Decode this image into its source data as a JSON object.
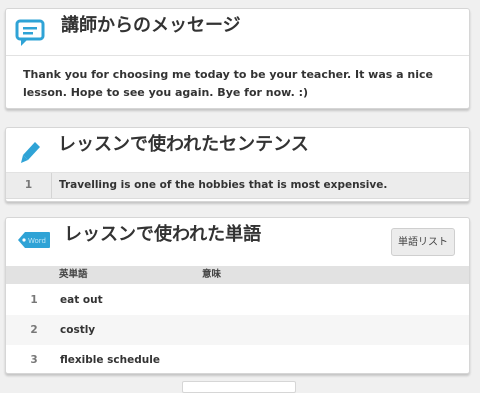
{
  "message_card": {
    "title": "講師からのメッセージ",
    "icon": "chat-bubble-icon",
    "body": "Thank you for choosing me today to be your teacher. It was a nice lesson. Hope to see you again. Bye for now. :)"
  },
  "sentences_card": {
    "title": "レッスンで使われたセンテンス",
    "icon": "pencil-icon",
    "rows": [
      {
        "num": "1",
        "text": "Travelling is one of the hobbies that is most expensive."
      }
    ]
  },
  "words_card": {
    "title": "レッスンで使われた単語",
    "icon": "word-tag-icon",
    "tag_text": "Word",
    "list_button": "単語リスト",
    "columns": [
      "英単語",
      "意味"
    ],
    "rows": [
      {
        "num": "1",
        "word": "eat out"
      },
      {
        "num": "2",
        "word": "costly"
      },
      {
        "num": "3",
        "word": "flexible schedule"
      }
    ]
  },
  "colors": {
    "accent": "#2fa3d6",
    "background": "#f0f0f0"
  }
}
